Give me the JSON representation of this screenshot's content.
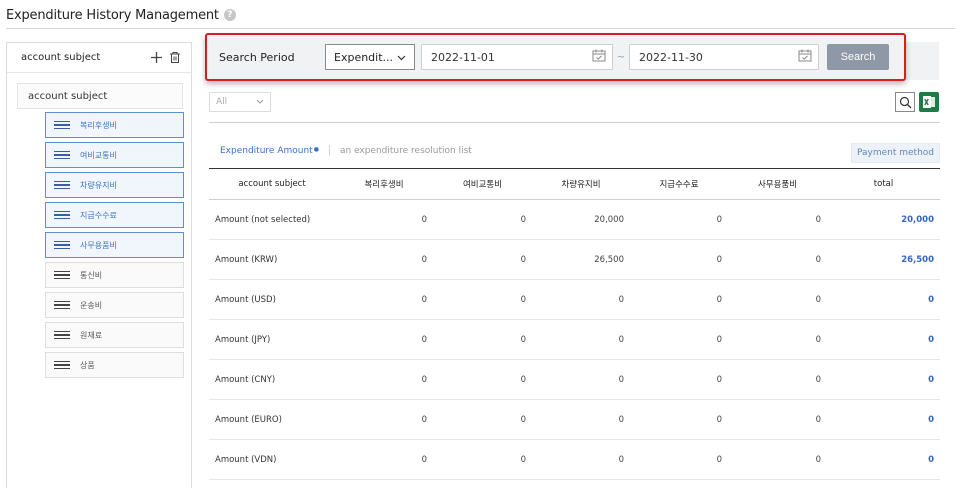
{
  "header": {
    "title": "Expenditure History Management",
    "help_icon": "question-mark-icon"
  },
  "left_panel": {
    "title": "account subject",
    "root": "account subject",
    "items": [
      {
        "label": "복리후생비",
        "selected": true
      },
      {
        "label": "여비교통비",
        "selected": true
      },
      {
        "label": "차량유지비",
        "selected": true
      },
      {
        "label": "지급수수료",
        "selected": true
      },
      {
        "label": "사무용품비",
        "selected": true
      },
      {
        "label": "통신비",
        "selected": false
      },
      {
        "label": "운송비",
        "selected": false
      },
      {
        "label": "원재료",
        "selected": false
      },
      {
        "label": "상품",
        "selected": false
      }
    ]
  },
  "search": {
    "label": "Search Period",
    "type_value": "Expendit...",
    "start_date": "2022-11-01",
    "separator": "~",
    "end_date": "2022-11-30",
    "button": "Search"
  },
  "filter": {
    "value": "All"
  },
  "tabs": {
    "active": "Expenditure Amount",
    "inactive": "an expenditure resolution list"
  },
  "payment_button": "Payment method",
  "table": {
    "headers": [
      "account subject",
      "복리후생비",
      "여비교통비",
      "차량유지비",
      "지급수수료",
      "사무용품비",
      "total"
    ],
    "rows": [
      [
        "Amount (not selected)",
        "0",
        "0",
        "20,000",
        "0",
        "0",
        "20,000"
      ],
      [
        "Amount (KRW)",
        "0",
        "0",
        "26,500",
        "0",
        "0",
        "26,500"
      ],
      [
        "Amount (USD)",
        "0",
        "0",
        "0",
        "0",
        "0",
        "0"
      ],
      [
        "Amount (JPY)",
        "0",
        "0",
        "0",
        "0",
        "0",
        "0"
      ],
      [
        "Amount (CNY)",
        "0",
        "0",
        "0",
        "0",
        "0",
        "0"
      ],
      [
        "Amount (EURO)",
        "0",
        "0",
        "0",
        "0",
        "0",
        "0"
      ],
      [
        "Amount (VDN)",
        "0",
        "0",
        "0",
        "0",
        "0",
        "0"
      ]
    ]
  },
  "colors": {
    "highlight": "#d31f1f",
    "accent": "#3465c4",
    "excel": "#1f7b45",
    "search_button": "#8e98a6"
  }
}
